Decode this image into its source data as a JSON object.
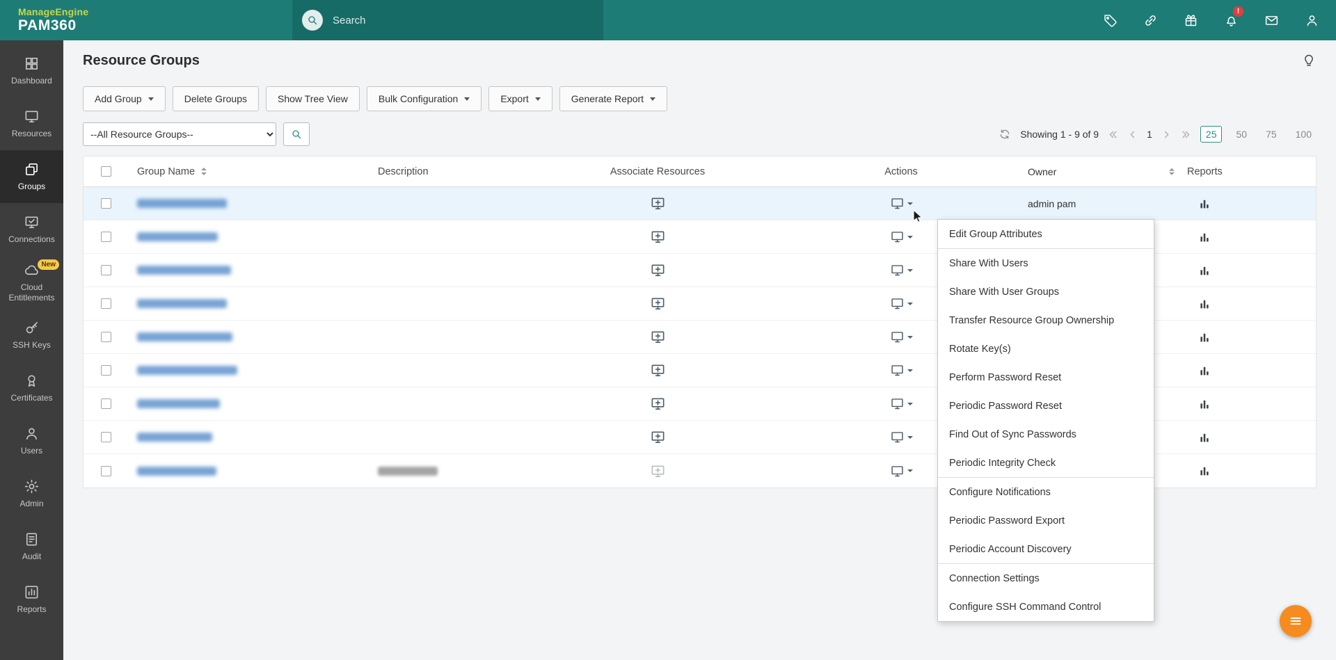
{
  "header": {
    "logo_brand": "ManageEngine",
    "logo_product": "PAM360",
    "search_placeholder": "Search",
    "notification_badge": "!"
  },
  "sidebar": {
    "items": [
      {
        "label": "Dashboard",
        "active": false
      },
      {
        "label": "Resources",
        "active": false
      },
      {
        "label": "Groups",
        "active": true
      },
      {
        "label": "Connections",
        "active": false
      },
      {
        "label": "Cloud Entitlements",
        "active": false,
        "badge": "New"
      },
      {
        "label": "SSH Keys",
        "active": false
      },
      {
        "label": "Certificates",
        "active": false
      },
      {
        "label": "Users",
        "active": false
      },
      {
        "label": "Admin",
        "active": false
      },
      {
        "label": "Audit",
        "active": false
      },
      {
        "label": "Reports",
        "active": false
      }
    ]
  },
  "page": {
    "title": "Resource Groups"
  },
  "toolbar": {
    "buttons": [
      {
        "label": "Add Group",
        "dropdown": true
      },
      {
        "label": "Delete Groups",
        "dropdown": false
      },
      {
        "label": "Show Tree View",
        "dropdown": false
      },
      {
        "label": "Bulk Configuration",
        "dropdown": true
      },
      {
        "label": "Export",
        "dropdown": true
      },
      {
        "label": "Generate Report",
        "dropdown": true
      }
    ]
  },
  "filter": {
    "selected_option": "--All Resource Groups--"
  },
  "pagination": {
    "showing_text": "Showing 1 - 9 of 9",
    "current_page": "1",
    "page_sizes": [
      "25",
      "50",
      "75",
      "100"
    ],
    "selected_page_size": "25"
  },
  "table": {
    "columns": [
      "Group Name",
      "Description",
      "Associate Resources",
      "Actions",
      "Owner",
      "Reports"
    ],
    "rows": [
      {
        "name_redacted": true,
        "owner": "admin pam",
        "selected": true
      },
      {
        "name_redacted": true
      },
      {
        "name_redacted": true
      },
      {
        "name_redacted": true
      },
      {
        "name_redacted": true
      },
      {
        "name_redacted": true
      },
      {
        "name_redacted": true
      },
      {
        "name_redacted": true
      },
      {
        "name_redacted": true,
        "description_redacted": true
      }
    ]
  },
  "context_menu": {
    "items": [
      "Edit Group Attributes",
      "Share With Users",
      "Share With User Groups",
      "Transfer Resource Group Ownership",
      "Rotate Key(s)",
      "Perform Password Reset",
      "Periodic Password Reset",
      "Find Out of Sync Passwords",
      "Periodic Integrity Check",
      "Configure Notifications",
      "Periodic Password Export",
      "Periodic Account Discovery",
      "Connection Settings",
      "Configure SSH Command Control"
    ]
  },
  "colors": {
    "header_teal": "#1e7c77",
    "accent_teal": "#2a8f88",
    "fab_orange": "#f68b1f",
    "row_highlight": "#e9f4fc",
    "link_blue": "#6899d0",
    "sidebar_bg": "#3d3d3d"
  }
}
